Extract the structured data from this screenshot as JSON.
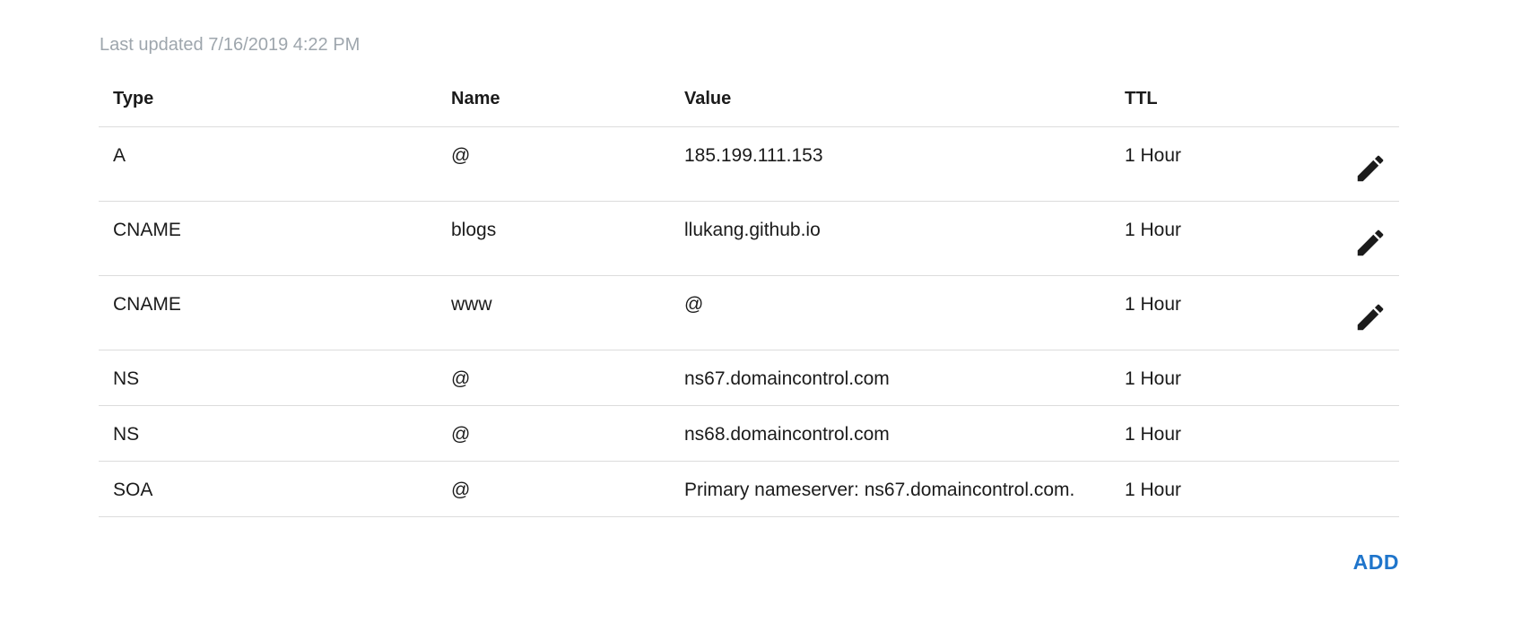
{
  "last_updated": "Last updated 7/16/2019 4:22 PM",
  "columns": {
    "type": "Type",
    "name": "Name",
    "value": "Value",
    "ttl": "TTL"
  },
  "records": [
    {
      "type": "A",
      "name": "@",
      "value": "185.199.111.153",
      "ttl": "1 Hour",
      "editable": true
    },
    {
      "type": "CNAME",
      "name": "blogs",
      "value": "llukang.github.io",
      "ttl": "1 Hour",
      "editable": true
    },
    {
      "type": "CNAME",
      "name": "www",
      "value": "@",
      "ttl": "1 Hour",
      "editable": true
    },
    {
      "type": "NS",
      "name": "@",
      "value": "ns67.domaincontrol.com",
      "ttl": "1 Hour",
      "editable": false
    },
    {
      "type": "NS",
      "name": "@",
      "value": "ns68.domaincontrol.com",
      "ttl": "1 Hour",
      "editable": false
    },
    {
      "type": "SOA",
      "name": "@",
      "value": "Primary nameserver: ns67.domaincontrol.com.",
      "ttl": "1 Hour",
      "editable": false
    }
  ],
  "edit_icon": "pencil-icon",
  "add_label": "ADD",
  "colors": {
    "accent": "#1f75cb",
    "muted_text": "#9ea6ad",
    "divider": "#dcdcdc"
  }
}
